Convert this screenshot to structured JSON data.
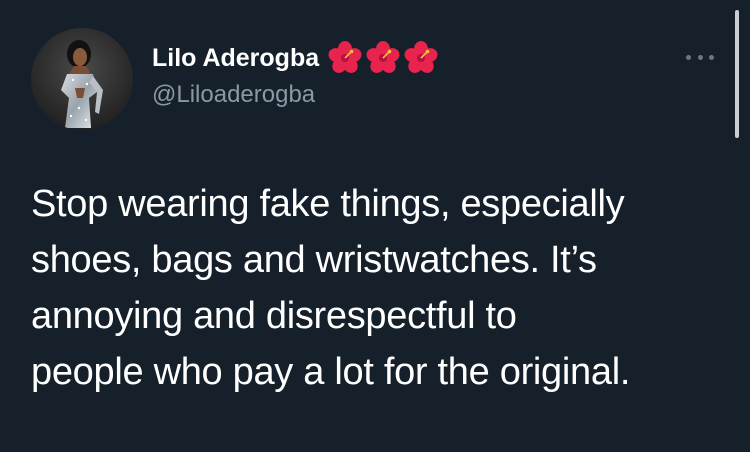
{
  "author": {
    "display_name": "Lilo Aderogba",
    "handle": "@Liloaderogba",
    "name_emojis": [
      "hibiscus-icon",
      "hibiscus-icon",
      "hibiscus-icon"
    ]
  },
  "tweet": {
    "lines": [
      "Stop wearing fake things, especially",
      "shoes, bags and wristwatches. It’s",
      "annoying and disrespectful to",
      "people who pay a lot for the original."
    ]
  },
  "colors": {
    "background": "#15202b",
    "text_primary": "#ffffff",
    "text_secondary": "#8b98a5",
    "hibiscus": "#e8234d"
  },
  "icons": {
    "more": "more-horizontal-icon"
  }
}
